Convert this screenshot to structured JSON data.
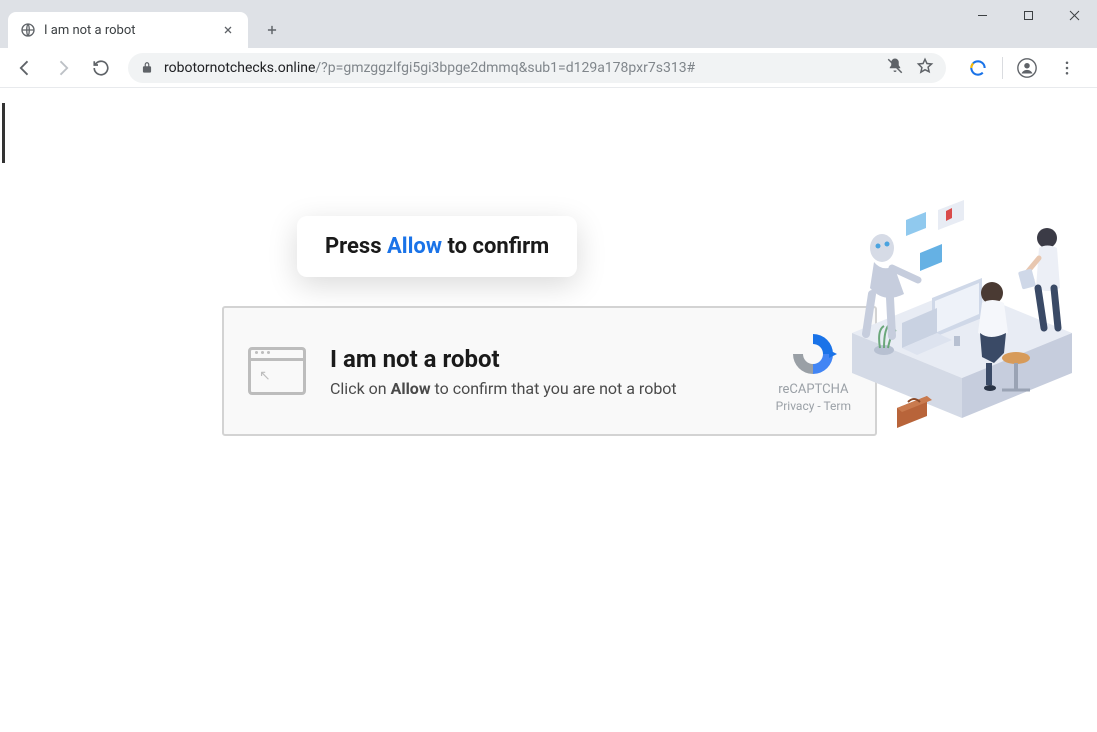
{
  "window": {
    "tab_title": "I am not a robot"
  },
  "toolbar": {
    "url_host": "robotornotchecks.online",
    "url_path": "/?p=gmzggzlfgi5gi3bpge2dmmq&sub1=d129a178pxr7s313#"
  },
  "page": {
    "press_allow": {
      "prefix": "Press ",
      "allow": "Allow",
      "suffix": " to confirm"
    },
    "captcha": {
      "title": "I am not a robot",
      "sub_prefix": "Click on ",
      "sub_bold": "Allow",
      "sub_suffix": " to confirm that you are not a robot"
    },
    "recaptcha": {
      "label": "reCAPTCHA",
      "privacy": "Privacy",
      "sep": " - ",
      "terms": "Term"
    }
  }
}
